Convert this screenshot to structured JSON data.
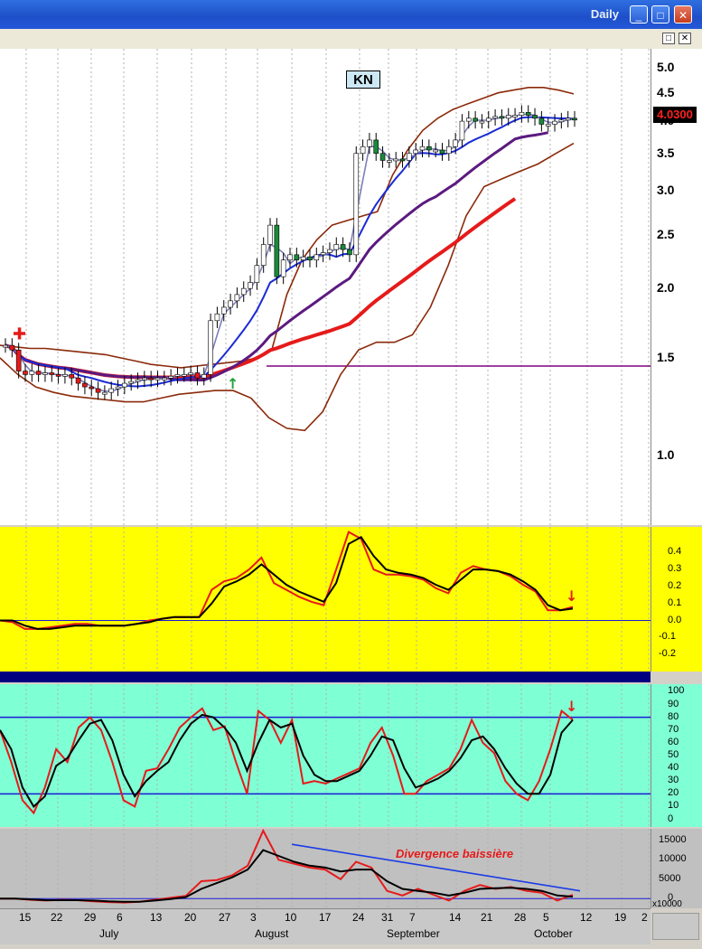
{
  "window": {
    "title": "Daily",
    "buttons": [
      "_",
      "□",
      "✕"
    ],
    "sub_buttons": [
      "□",
      "✕"
    ]
  },
  "chart_data": [
    {
      "type": "candlestick",
      "ticker": "KN",
      "last_price": "4.0300",
      "scale": "log",
      "ylim": [
        0.75,
        5.4
      ],
      "y_ticks": [
        "5.0",
        "4.5",
        "4.0",
        "3.5",
        "3.0",
        "2.5",
        "2.0",
        "1.5",
        "1.0"
      ],
      "y_tick_values": [
        5.0,
        4.5,
        4.0,
        3.5,
        3.0,
        2.5,
        2.0,
        1.5,
        1.0
      ],
      "horizontal_line": 1.45,
      "close": [
        1.58,
        1.55,
        1.42,
        1.4,
        1.42,
        1.4,
        1.41,
        1.4,
        1.39,
        1.4,
        1.38,
        1.35,
        1.33,
        1.32,
        1.3,
        1.3,
        1.32,
        1.33,
        1.35,
        1.36,
        1.37,
        1.38,
        1.37,
        1.38,
        1.38,
        1.39,
        1.4,
        1.4,
        1.41,
        1.38,
        1.4,
        1.75,
        1.8,
        1.85,
        1.9,
        1.95,
        2.0,
        2.05,
        2.2,
        2.4,
        2.6,
        2.1,
        2.25,
        2.3,
        2.25,
        2.28,
        2.25,
        2.3,
        2.32,
        2.35,
        2.4,
        2.35,
        2.3,
        3.5,
        3.6,
        3.7,
        3.5,
        3.4,
        3.4,
        3.42,
        3.4,
        3.5,
        3.55,
        3.6,
        3.55,
        3.55,
        3.5,
        3.6,
        3.7,
        4.0,
        4.05,
        4.0,
        4.0,
        4.05,
        4.08,
        4.05,
        4.1,
        4.1,
        4.15,
        4.1,
        4.05,
        3.95,
        3.95,
        4.0,
        4.02,
        4.05,
        4.03
      ],
      "bands": {
        "upper": [
          1.58,
          1.57,
          1.56,
          1.56,
          1.55,
          1.54,
          1.53,
          1.52,
          1.5,
          1.48,
          1.46,
          1.45,
          1.44,
          1.45,
          1.46,
          1.47,
          1.48,
          1.5,
          1.55,
          1.95,
          2.25,
          2.45,
          2.6,
          2.65,
          2.7,
          2.75,
          3.2,
          3.55,
          3.85,
          4.05,
          4.2,
          4.3,
          4.4,
          4.5,
          4.55,
          4.6,
          4.6,
          4.55,
          4.48
        ],
        "lower": [
          1.5,
          1.4,
          1.33,
          1.3,
          1.28,
          1.27,
          1.26,
          1.25,
          1.25,
          1.27,
          1.29,
          1.3,
          1.31,
          1.31,
          1.27,
          1.17,
          1.12,
          1.11,
          1.2,
          1.4,
          1.55,
          1.6,
          1.6,
          1.65,
          1.85,
          2.2,
          2.7,
          3.05,
          3.15,
          3.25,
          3.35,
          3.5,
          3.65
        ]
      },
      "moving_averages": [
        "blue",
        "purple",
        "red",
        "gray"
      ]
    },
    {
      "type": "line",
      "ylim": [
        -0.3,
        0.55
      ],
      "y_ticks": [
        "0.4",
        "0.3",
        "0.2",
        "0.1",
        "0.0",
        "-0.1",
        "-0.2"
      ],
      "y_tick_values": [
        0.4,
        0.3,
        0.2,
        0.1,
        0.0,
        -0.1,
        -0.2
      ],
      "series": [
        {
          "color": "#e61a1a",
          "values": [
            0.0,
            -0.01,
            -0.05,
            -0.05,
            -0.04,
            -0.03,
            -0.02,
            -0.02,
            -0.03,
            -0.03,
            -0.03,
            -0.02,
            0.0,
            0.01,
            0.02,
            0.02,
            0.02,
            0.18,
            0.23,
            0.25,
            0.3,
            0.37,
            0.22,
            0.18,
            0.14,
            0.11,
            0.09,
            0.3,
            0.52,
            0.48,
            0.3,
            0.27,
            0.27,
            0.26,
            0.24,
            0.19,
            0.16,
            0.28,
            0.32,
            0.3,
            0.29,
            0.26,
            0.21,
            0.17,
            0.06,
            0.06,
            0.08
          ]
        },
        {
          "color": "#000000",
          "values": [
            0.0,
            0.0,
            -0.03,
            -0.05,
            -0.05,
            -0.04,
            -0.03,
            -0.03,
            -0.03,
            -0.03,
            -0.03,
            -0.02,
            -0.01,
            0.01,
            0.02,
            0.02,
            0.02,
            0.1,
            0.2,
            0.23,
            0.27,
            0.33,
            0.27,
            0.21,
            0.17,
            0.14,
            0.11,
            0.22,
            0.45,
            0.49,
            0.38,
            0.3,
            0.28,
            0.27,
            0.25,
            0.21,
            0.18,
            0.24,
            0.3,
            0.3,
            0.29,
            0.27,
            0.23,
            0.18,
            0.09,
            0.06,
            0.07
          ]
        }
      ]
    },
    {
      "type": "line",
      "ylim": [
        -6,
        106
      ],
      "y_ticks": [
        "100",
        "90",
        "80",
        "70",
        "60",
        "50",
        "40",
        "30",
        "20",
        "10",
        "0"
      ],
      "y_tick_values": [
        100,
        90,
        80,
        70,
        60,
        50,
        40,
        30,
        20,
        10,
        0
      ],
      "levels": [
        20,
        80
      ],
      "series": [
        {
          "color": "#e61a1a",
          "values": [
            70,
            45,
            15,
            5,
            25,
            55,
            45,
            72,
            80,
            70,
            45,
            15,
            10,
            38,
            40,
            55,
            72,
            80,
            87,
            70,
            73,
            45,
            20,
            85,
            78,
            60,
            78,
            28,
            30,
            28,
            32,
            36,
            40,
            60,
            72,
            50,
            20,
            20,
            30,
            35,
            40,
            55,
            78,
            60,
            52,
            30,
            20,
            15,
            30,
            55,
            85,
            78
          ]
        },
        {
          "color": "#000000",
          "values": [
            70,
            55,
            25,
            10,
            18,
            42,
            48,
            62,
            75,
            78,
            62,
            35,
            18,
            30,
            38,
            45,
            62,
            75,
            82,
            80,
            72,
            60,
            38,
            60,
            78,
            72,
            75,
            50,
            35,
            30,
            30,
            34,
            38,
            50,
            65,
            62,
            40,
            25,
            28,
            32,
            38,
            48,
            62,
            65,
            55,
            40,
            28,
            20,
            20,
            35,
            68,
            78
          ]
        }
      ]
    },
    {
      "type": "line",
      "ylim": [
        -2500,
        18000
      ],
      "y_ticks": [
        "15000",
        "10000",
        "5000",
        "0"
      ],
      "y_tick_values": [
        15000,
        10000,
        5000,
        0
      ],
      "y_unit": "x10000",
      "series": [
        {
          "color": "#e61a1a",
          "values": [
            0,
            0,
            -300,
            -500,
            -300,
            -400,
            -700,
            -900,
            -1000,
            -800,
            -300,
            200,
            700,
            4500,
            4800,
            6000,
            8500,
            17500,
            10000,
            9000,
            8000,
            7500,
            5000,
            9500,
            8000,
            2000,
            800,
            2500,
            1000,
            -500,
            2000,
            3500,
            2500,
            3000,
            2000,
            1500,
            -500,
            1000
          ]
        },
        {
          "color": "#000000",
          "values": [
            0,
            0,
            -200,
            -400,
            -400,
            -400,
            -500,
            -700,
            -800,
            -800,
            -500,
            -100,
            400,
            2500,
            4000,
            5500,
            7500,
            12500,
            11000,
            9500,
            8500,
            8000,
            7000,
            7500,
            7500,
            4500,
            2500,
            2000,
            1500,
            800,
            1500,
            2500,
            2700,
            2800,
            2500,
            2000,
            800,
            500
          ]
        },
        {
          "color": "#1a3be6",
          "values": [
            14000,
            2000
          ]
        }
      ],
      "annotation": "Divergence baissière"
    }
  ],
  "x_axis": {
    "ticks": [
      "15",
      "22",
      "29",
      "6",
      "13",
      "20",
      "27",
      "3",
      "10",
      "17",
      "24",
      "31",
      "7",
      "14",
      "21",
      "28",
      "5",
      "12",
      "19",
      "2"
    ],
    "months": [
      "July",
      "August",
      "September",
      "October"
    ]
  },
  "colors": {
    "macd_bg": "#ffff00",
    "stoch_bg": "#7fffd4",
    "volume_bg": "#c0c0c0",
    "price_bg": "#ffffff",
    "signal_arrow": "#e61a1a",
    "buy_arrow": "#1aa33b"
  }
}
